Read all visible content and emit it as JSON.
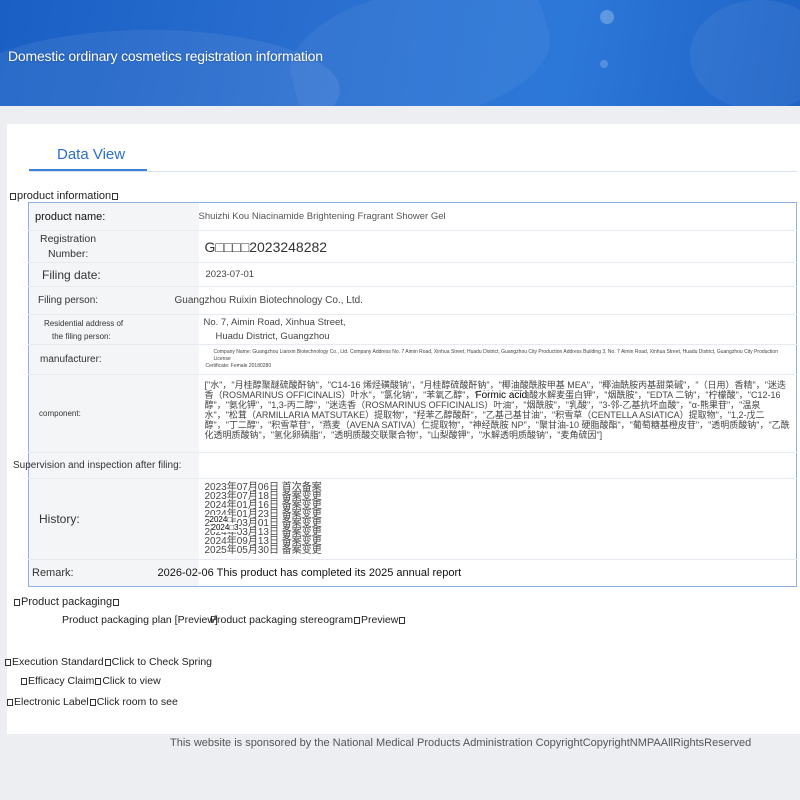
{
  "banner": {
    "title": "Domestic ordinary cosmetics registration information"
  },
  "tab": {
    "label": "Data View"
  },
  "product_info": {
    "section_label": "product information",
    "rows": {
      "product_name": {
        "label": "product name:",
        "value": "Shuizhi Kou Niacinamide Brightening Fragrant Shower Gel"
      },
      "reg_number": {
        "label_line1": "Registration",
        "label_line2": "Number:",
        "value": "G□□□□2023248282"
      },
      "filing_date": {
        "label": "Filing date:",
        "value": "2023-07-01"
      },
      "filing_person": {
        "label": "Filing person:",
        "value": "Guangzhou Ruixin Biotechnology Co., Ltd."
      },
      "residential": {
        "label_line1": "Residential address of",
        "label_line2": "the filing person:",
        "value_line1": "No. 7, Aimin Road, Xinhua Street,",
        "value_line2": "Huadu District, Guangzhou"
      },
      "manufacturer": {
        "label": "manufacturer:",
        "value_line1": "Company Name: Guangzhou Lianxin Biotechnology Co., Ltd. Company Address No. 7 Aimin Road, Xinhua Street, Huadu District, Guangzhou City Production Address Building 3, No. 7 Aimin Road, Xinhua Street, Huadu District, Guangzhou City Production License",
        "value_line2": "Certificate: Female 20180280"
      },
      "component": {
        "label": "component:",
        "value": "[\"水\"，\"月桂醇聚醚硫酸酐钠\"，\"C14-16 烯烃磺酸钠\"，\"月桂醇硫酸酐钠\"，\"椰油酸酰胺甲基 MEA\"，\"椰油酰胺丙基甜菜碱\"，\"（日用）香精\"，\"迷迭香（ROSMARINUS OFFICINALIS）叶水\"，\"氯化钠\"，\"苯氧乙醇\"，\"甘油\"，\"椰油酸水解麦蛋白钾\"，\"烟酰胺\"，\"EDTA 二钠\"，\"柠檬酸\"，\"C12-16 醇\"，\"氨化钾\"，\"1,3-丙二醇\"，\"迷迭香（ROSMARINUS OFFICINALIS）叶油\"，\"烟酰胺\"，\"乳酸\"，\"3-邻-乙基抗坏血酸\"，\"α-熊果苷\"，\"温泉水\"，\"松茸（ARMILLARIA MATSUTAKE）提取物\"，\"羟苯乙醇酸酐\"，\"乙基己基甘油\"，\"积雪草（CENTELLA ASIATICA）提取物\"，\"1,2-戊二醇\"，\"丁二醇\"，\"积雪草苷\"，\"燕麦（AVENA SATIVA）仁提取物\"，\"神经酰胺 NP\"，\"聚甘油-10 硬脂酸酯\"，\"葡萄糖基橙皮苷\"，\"透明质酸钠\"，\"乙酰化透明质酸钠\"，\"氢化卵磷脂\"，\"透明质酸交联聚合物\"，\"山梨酸钾\"，\"水解透明质酸钠\"，\"麦角硫因\"]",
        "overlay": "Formic acid"
      },
      "supervision": {
        "label": "Supervision and inspection after filing:"
      },
      "history": {
        "label": "History:",
        "entries": [
          "2023年07月06日 首次备案",
          "2023年07月18日 备案变更",
          "2024年01月16日 备案变更",
          "2024年01月23日 备案变更",
          "2024年03月01日 备案变更",
          "2024年03月13日 备案变更",
          "2024年09月13日 备案变更",
          "2025年05月30日 备案变更"
        ],
        "overlay1": "2024□",
        "overlay2": "2024□3"
      },
      "remark": {
        "label": "Remark:",
        "value": "2026-02-06 This product has completed its 2025 annual report"
      }
    }
  },
  "packaging": {
    "section_label": "Product packaging",
    "plan_link": "Product packaging plan [Preview]",
    "stereogram_label": "Product packaging stereogram",
    "stereogram_link": "Preview"
  },
  "execution": {
    "label": "Execution Standard",
    "link": "Click to Check Spring"
  },
  "efficacy": {
    "label": "Efficacy Claim",
    "link": "Click to view"
  },
  "electronic": {
    "label": "Electronic Label",
    "link": "Click room to see"
  },
  "footer": {
    "text": "This website is sponsored by the National Medical Products Administration CopyrightCopyrightNMPAAllRightsReserved"
  },
  "colors": {
    "banner": "#2a6fd0",
    "tab_accent": "#2a6fc9",
    "table_border": "#8fb1dd"
  }
}
